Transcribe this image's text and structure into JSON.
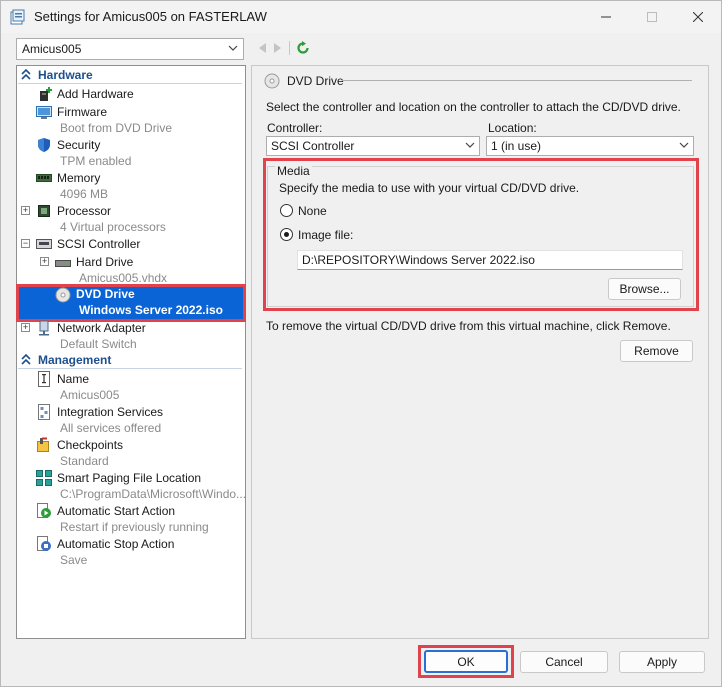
{
  "window": {
    "title": "Settings for Amicus005 on FASTERLAW"
  },
  "vm_selector": {
    "value": "Amicus005"
  },
  "sections": {
    "hardware": "Hardware",
    "management": "Management"
  },
  "hardware_items": [
    {
      "label": "Add Hardware",
      "sub": ""
    },
    {
      "label": "Firmware",
      "sub": "Boot from DVD Drive"
    },
    {
      "label": "Security",
      "sub": "TPM enabled"
    },
    {
      "label": "Memory",
      "sub": "4096 MB"
    },
    {
      "label": "Processor",
      "sub": "4 Virtual processors"
    },
    {
      "label": "SCSI Controller",
      "sub": ""
    },
    {
      "label": "Hard Drive",
      "sub": "Amicus005.vhdx"
    },
    {
      "label": "DVD Drive",
      "sub": "Windows Server 2022.iso"
    },
    {
      "label": "Network Adapter",
      "sub": "Default Switch"
    }
  ],
  "management_items": [
    {
      "label": "Name",
      "sub": "Amicus005"
    },
    {
      "label": "Integration Services",
      "sub": "All services offered"
    },
    {
      "label": "Checkpoints",
      "sub": "Standard"
    },
    {
      "label": "Smart Paging File Location",
      "sub": "C:\\ProgramData\\Microsoft\\Windo..."
    },
    {
      "label": "Automatic Start Action",
      "sub": "Restart if previously running"
    },
    {
      "label": "Automatic Stop Action",
      "sub": "Save"
    }
  ],
  "dvd_panel": {
    "title": "DVD Drive",
    "description": "Select the controller and location on the controller to attach the CD/DVD drive.",
    "controller_label": "Controller:",
    "controller_value": "SCSI Controller",
    "location_label": "Location:",
    "location_value": "1 (in use)",
    "media_legend": "Media",
    "media_description": "Specify the media to use with your virtual CD/DVD drive.",
    "none_label": "None",
    "image_label": "Image file:",
    "image_path": "D:\\REPOSITORY\\Windows Server 2022.iso",
    "browse_label": "Browse...",
    "remove_note": "To remove the virtual CD/DVD drive from this virtual machine, click Remove.",
    "remove_label": "Remove"
  },
  "footer": {
    "ok_label": "OK",
    "cancel_label": "Cancel",
    "apply_label": "Apply"
  },
  "colors": {
    "selection": "#0a64d6",
    "section_header": "#1e4f8f",
    "highlight_box": "#e0434b"
  }
}
